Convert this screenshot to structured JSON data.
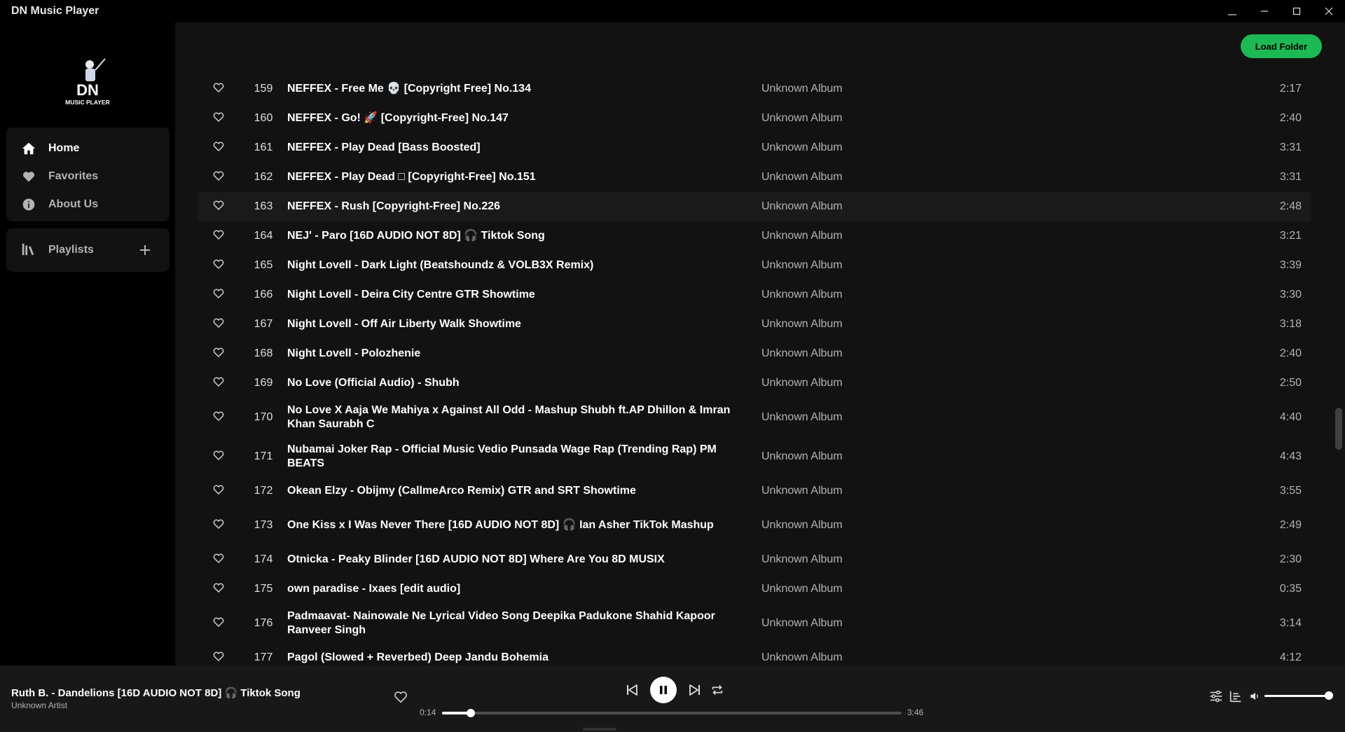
{
  "window": {
    "title": "DN Music Player"
  },
  "sidebar": {
    "logo_text": "DN",
    "logo_subtext": "MUSIC PLAYER",
    "nav": [
      {
        "label": "Home",
        "icon": "home-icon",
        "active": true
      },
      {
        "label": "Favorites",
        "icon": "heart-icon",
        "active": false
      },
      {
        "label": "About Us",
        "icon": "info-icon",
        "active": false
      }
    ],
    "playlists_label": "Playlists"
  },
  "main": {
    "load_folder_label": "Load Folder",
    "tracks": [
      {
        "num": "159",
        "title": "NEFFEX - Free Me 💀 [Copyright Free] No.134",
        "album": "Unknown Album",
        "duration": "2:17"
      },
      {
        "num": "160",
        "title": "NEFFEX - Go! 🚀 [Copyright-Free] No.147",
        "album": "Unknown Album",
        "duration": "2:40"
      },
      {
        "num": "161",
        "title": "NEFFEX - Play Dead [Bass Boosted]",
        "album": "Unknown Album",
        "duration": "3:31"
      },
      {
        "num": "162",
        "title": "NEFFEX - Play Dead □ [Copyright-Free] No.151",
        "album": "Unknown Album",
        "duration": "3:31"
      },
      {
        "num": "163",
        "title": "NEFFEX - Rush [Copyright-Free] No.226",
        "album": "Unknown Album",
        "duration": "2:48",
        "highlighted": true
      },
      {
        "num": "164",
        "title": "NEJ' - Paro [16D AUDIO NOT 8D] 🎧 Tiktok Song",
        "album": "Unknown Album",
        "duration": "3:21"
      },
      {
        "num": "165",
        "title": "Night Lovell - Dark Light (Beatshoundz & VOLB3X Remix)",
        "album": "Unknown Album",
        "duration": "3:39"
      },
      {
        "num": "166",
        "title": "Night Lovell - Deira City Centre GTR Showtime",
        "album": "Unknown Album",
        "duration": "3:30"
      },
      {
        "num": "167",
        "title": "Night Lovell - Off Air Liberty Walk Showtime",
        "album": "Unknown Album",
        "duration": "3:18"
      },
      {
        "num": "168",
        "title": "Night Lovell - Polozhenie",
        "album": "Unknown Album",
        "duration": "2:40"
      },
      {
        "num": "169",
        "title": "No Love (Official Audio) - Shubh",
        "album": "Unknown Album",
        "duration": "2:50"
      },
      {
        "num": "170",
        "title": "No Love X Aaja We Mahiya x Against All Odd - Mashup Shubh ft.AP Dhillon & Imran Khan Saurabh C",
        "album": "Unknown Album",
        "duration": "4:40"
      },
      {
        "num": "171",
        "title": "Nubamai Joker Rap - Official Music Vedio Punsada Wage Rap (Trending Rap) PM BEATS",
        "album": "Unknown Album",
        "duration": "4:43"
      },
      {
        "num": "172",
        "title": "Okean Elzy - Obijmy (CallmeArco Remix) GTR and SRT Showtime",
        "album": "Unknown Album",
        "duration": "3:55"
      },
      {
        "num": "173",
        "title": "One Kiss x I Was Never There [16D AUDIO NOT 8D] 🎧 Ian Asher TikTok Mashup",
        "album": "Unknown Album",
        "duration": "2:49"
      },
      {
        "num": "174",
        "title": "Otnicka - Peaky Blinder [16D AUDIO NOT 8D] Where Are You 8D MUSIX",
        "album": "Unknown Album",
        "duration": "2:30"
      },
      {
        "num": "175",
        "title": "own paradise - Ixaes [edit audio]",
        "album": "Unknown Album",
        "duration": "0:35"
      },
      {
        "num": "176",
        "title": "Padmaavat- Nainowale Ne Lyrical Video Song Deepika Padukone Shahid Kapoor Ranveer Singh",
        "album": "Unknown Album",
        "duration": "3:14"
      },
      {
        "num": "177",
        "title": "Pagol (Slowed + Reverbed) Deep Jandu Bohemia",
        "album": "Unknown Album",
        "duration": "4:12"
      }
    ]
  },
  "player": {
    "now_title": "Ruth B. - Dandelions [16D AUDIO NOT 8D] 🎧 Tiktok Song",
    "now_artist": "Unknown Artist",
    "current_time": "0:14",
    "total_time": "3:46",
    "progress_fraction": 0.062,
    "volume_fraction": 1.0
  },
  "colors": {
    "accent": "#1db954",
    "main_bg": "#121212",
    "sidebar_bg": "#000000",
    "player_bg": "#181818"
  }
}
